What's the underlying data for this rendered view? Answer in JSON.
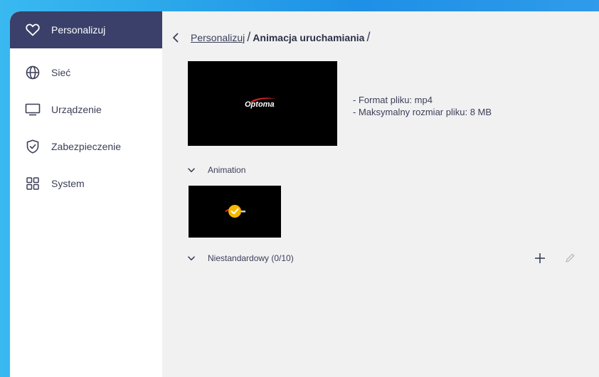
{
  "sidebar": {
    "items": [
      {
        "label": "Personalizuj",
        "icon": "heart-icon",
        "active": true
      },
      {
        "label": "Sieć",
        "icon": "globe-icon"
      },
      {
        "label": "Urządzenie",
        "icon": "monitor-icon"
      },
      {
        "label": "Zabezpieczenie",
        "icon": "shield-check-icon"
      },
      {
        "label": "System",
        "icon": "grid-icon"
      }
    ]
  },
  "breadcrumb": {
    "parent": "Personalizuj",
    "separator": "/",
    "current": "Animacja uruchamiania",
    "trailing": "/"
  },
  "preview": {
    "logo": "Optoma",
    "info_lines": [
      "- Format pliku: mp4",
      "- Maksymalny rozmiar pliku: 8 MB"
    ]
  },
  "sections": {
    "animation": {
      "label": "Animation",
      "selected": true
    },
    "custom": {
      "label": "Niestandardowy (0/10)"
    }
  },
  "colors": {
    "accent": "#f5b800",
    "sidebar_active": "#3a4069",
    "logo_red": "#d8232a"
  }
}
